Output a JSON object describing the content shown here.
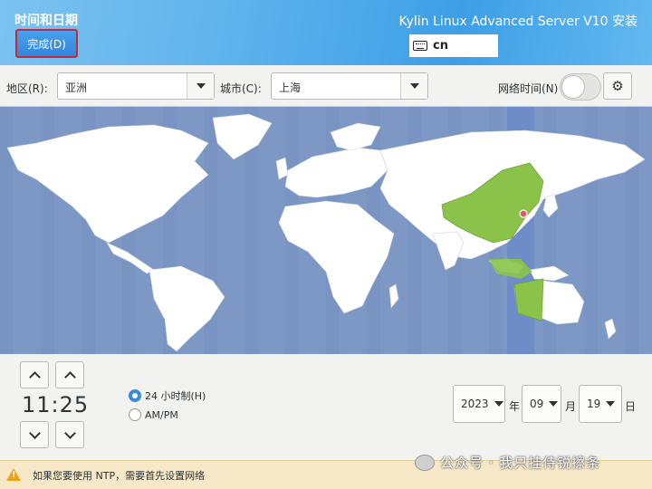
{
  "header": {
    "title": "时间和日期",
    "done_button": "完成(D)",
    "product": "Kylin Linux Advanced Server V10 安装",
    "keyboard_layout": "cn"
  },
  "toolbar": {
    "region_label": "地区(R):",
    "region_value": "亚洲",
    "city_label": "城市(C):",
    "city_value": "上海",
    "network_time_label": "网络时间(N)",
    "network_time_enabled": false
  },
  "map": {
    "selected_city": "上海",
    "selected_zone_color": "#8bc34a",
    "ocean_color": "#7e98c6",
    "land_color": "#ffffff"
  },
  "time": {
    "value": "11:25",
    "format_24h_label": "24 小时制(H)",
    "format_ampm_label": "AM/PM",
    "selected_format": "24h"
  },
  "date": {
    "year": "2023",
    "year_unit": "年",
    "month": "09",
    "month_unit": "月",
    "day": "19",
    "day_unit": "日"
  },
  "warning": {
    "text": "如果您要使用 NTP，需要首先设置网络"
  },
  "watermark": {
    "text": "公众号 · 我只挂侍锐擦条"
  },
  "colors": {
    "header_blue": "#3e9fe6",
    "accent_red": "#c52a3a",
    "radio_blue": "#3b8ad9",
    "warning_bg": "#f7e9c7"
  }
}
